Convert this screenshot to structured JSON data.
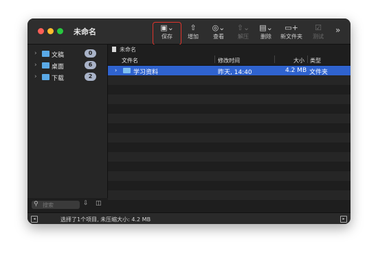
{
  "window": {
    "title": "未命名"
  },
  "toolbar": {
    "save": {
      "label": "保存",
      "icon": "save-icon"
    },
    "add": {
      "label": "增加",
      "icon": "add-icon"
    },
    "view": {
      "label": "查看",
      "icon": "view-icon"
    },
    "extract": {
      "label": "解压",
      "icon": "extract-icon"
    },
    "delete": {
      "label": "删除",
      "icon": "delete-icon"
    },
    "new_folder": {
      "label": "新文件夹",
      "icon": "new-folder-icon"
    },
    "test": {
      "label": "测试",
      "icon": "test-icon"
    },
    "more": {
      "label": "»"
    }
  },
  "sidebar": {
    "items": [
      {
        "label": "文稿",
        "count": "0"
      },
      {
        "label": "桌面",
        "count": "6"
      },
      {
        "label": "下载",
        "count": "2"
      }
    ],
    "search": {
      "placeholder": "搜索"
    }
  },
  "main": {
    "path": "未命名",
    "columns": {
      "name": "文件名",
      "modified": "修改时间",
      "size": "大小",
      "type": "类型"
    },
    "rows": [
      {
        "name": "学习资料",
        "modified": "昨天, 14:40",
        "size": "4.2 MB",
        "type": "文件夹",
        "selected": true
      }
    ]
  },
  "status": {
    "text": "选择了1个项目, 未压缩大小: 4.2 MB"
  },
  "colors": {
    "selection": "#2f63cf",
    "highlight": "#e0342c",
    "folder": "#5aa9e6"
  }
}
